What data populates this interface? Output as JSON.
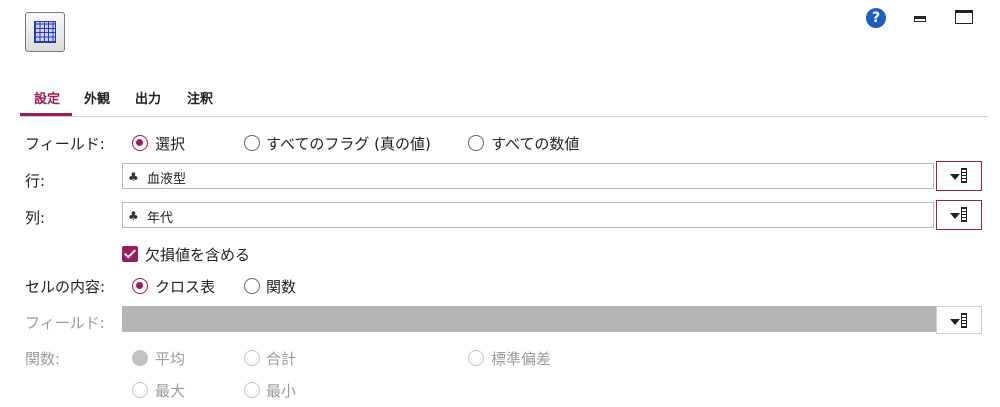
{
  "header": {
    "help_glyph": "?"
  },
  "tabs": [
    {
      "label": "設定",
      "active": true
    },
    {
      "label": "外観"
    },
    {
      "label": "出力"
    },
    {
      "label": "注釈"
    }
  ],
  "fields_row": {
    "label": "フィールド:",
    "options": [
      "選択",
      "すべてのフラグ (真の値)",
      "すべての数値"
    ],
    "selected": "選択"
  },
  "row_field": {
    "label": "行:",
    "value": "血液型",
    "icon": "nominal-field-icon"
  },
  "col_field": {
    "label": "列:",
    "value": "年代",
    "icon": "nominal-field-icon"
  },
  "missing_checkbox": {
    "label": "欠損値を含める",
    "checked": true
  },
  "cell_contents": {
    "label": "セルの内容:",
    "options": [
      "クロス表",
      "関数"
    ],
    "selected": "クロス表"
  },
  "function_field": {
    "label": "フィールド:",
    "value": ""
  },
  "function": {
    "label": "関数:",
    "options": [
      "平均",
      "合計",
      "標準偏差",
      "最大",
      "最小"
    ],
    "selected": "平均"
  },
  "colors": {
    "accent": "#9b1c5a",
    "help": "#1f5fbf",
    "disabled_field": "#b5b5b5"
  }
}
